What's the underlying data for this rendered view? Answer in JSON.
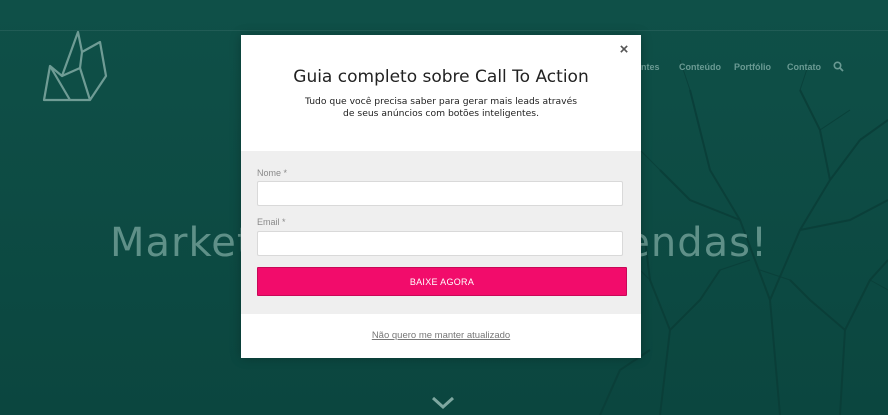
{
  "site": {
    "nav": [
      "ntes",
      "Conteúdo",
      "Portfólio",
      "Contato"
    ],
    "hero_left": "Market",
    "hero_right": "vendas!",
    "icons": {
      "logo": "brand-logo-icon",
      "search": "search-icon",
      "scroll": "chevron-down-icon"
    }
  },
  "modal": {
    "close_label": "×",
    "title": "Guia completo sobre Call To Action",
    "subtitle": "Tudo que você precisa saber para gerar mais leads através de seus anúncios com botões inteligentes.",
    "fields": [
      {
        "label": "Nome *",
        "value": "",
        "placeholder": ""
      },
      {
        "label": "Email *",
        "value": "",
        "placeholder": ""
      }
    ],
    "submit_label": "BAIXE AGORA",
    "decline_label": "Não quero me manter atualizado",
    "colors": {
      "accent": "#f20c6b",
      "overlay": "#0d4c45"
    }
  }
}
